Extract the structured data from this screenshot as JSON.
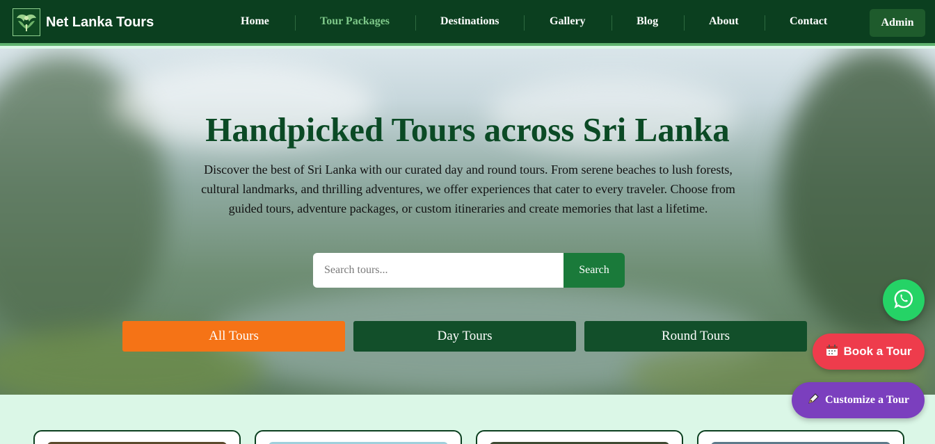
{
  "brand": {
    "name": "Net Lanka Tours",
    "icon": "winged-emblem-icon"
  },
  "nav": {
    "items": [
      {
        "label": "Home",
        "active": false
      },
      {
        "label": "Tour Packages",
        "active": true
      },
      {
        "label": "Destinations",
        "active": false
      },
      {
        "label": "Gallery",
        "active": false
      },
      {
        "label": "Blog",
        "active": false
      },
      {
        "label": "About",
        "active": false
      },
      {
        "label": "Contact",
        "active": false
      }
    ],
    "admin_label": "Admin"
  },
  "hero": {
    "title": "Handpicked Tours across Sri Lanka",
    "description": "Discover the best of Sri Lanka with our curated day and round tours. From serene beaches to lush forests, cultural landmarks, and thrilling adventures, we offer experiences that cater to every traveler. Choose from guided tours, adventure packages, or custom itineraries and create memories that last a lifetime.",
    "search": {
      "placeholder": "Search tours...",
      "value": "",
      "button_label": "Search"
    },
    "tabs": [
      {
        "label": "All Tours",
        "active": true
      },
      {
        "label": "Day Tours",
        "active": false
      },
      {
        "label": "Round Tours",
        "active": false
      }
    ]
  },
  "floating": {
    "whatsapp_icon": "whatsapp-icon",
    "book_label": "Book a Tour",
    "book_icon": "calendar-icon",
    "customize_label": "Customize a Tour",
    "customize_icon": "pen-icon"
  },
  "colors": {
    "nav_bg": "#0b3f1f",
    "accent_green": "#1a7a3a",
    "tab_active": "#f57316",
    "tab_inactive": "#124f2a",
    "whatsapp": "#25d366",
    "book": "#ee3c4c",
    "customize": "#7b3fbe",
    "page_bg": "#dbf7e7"
  }
}
